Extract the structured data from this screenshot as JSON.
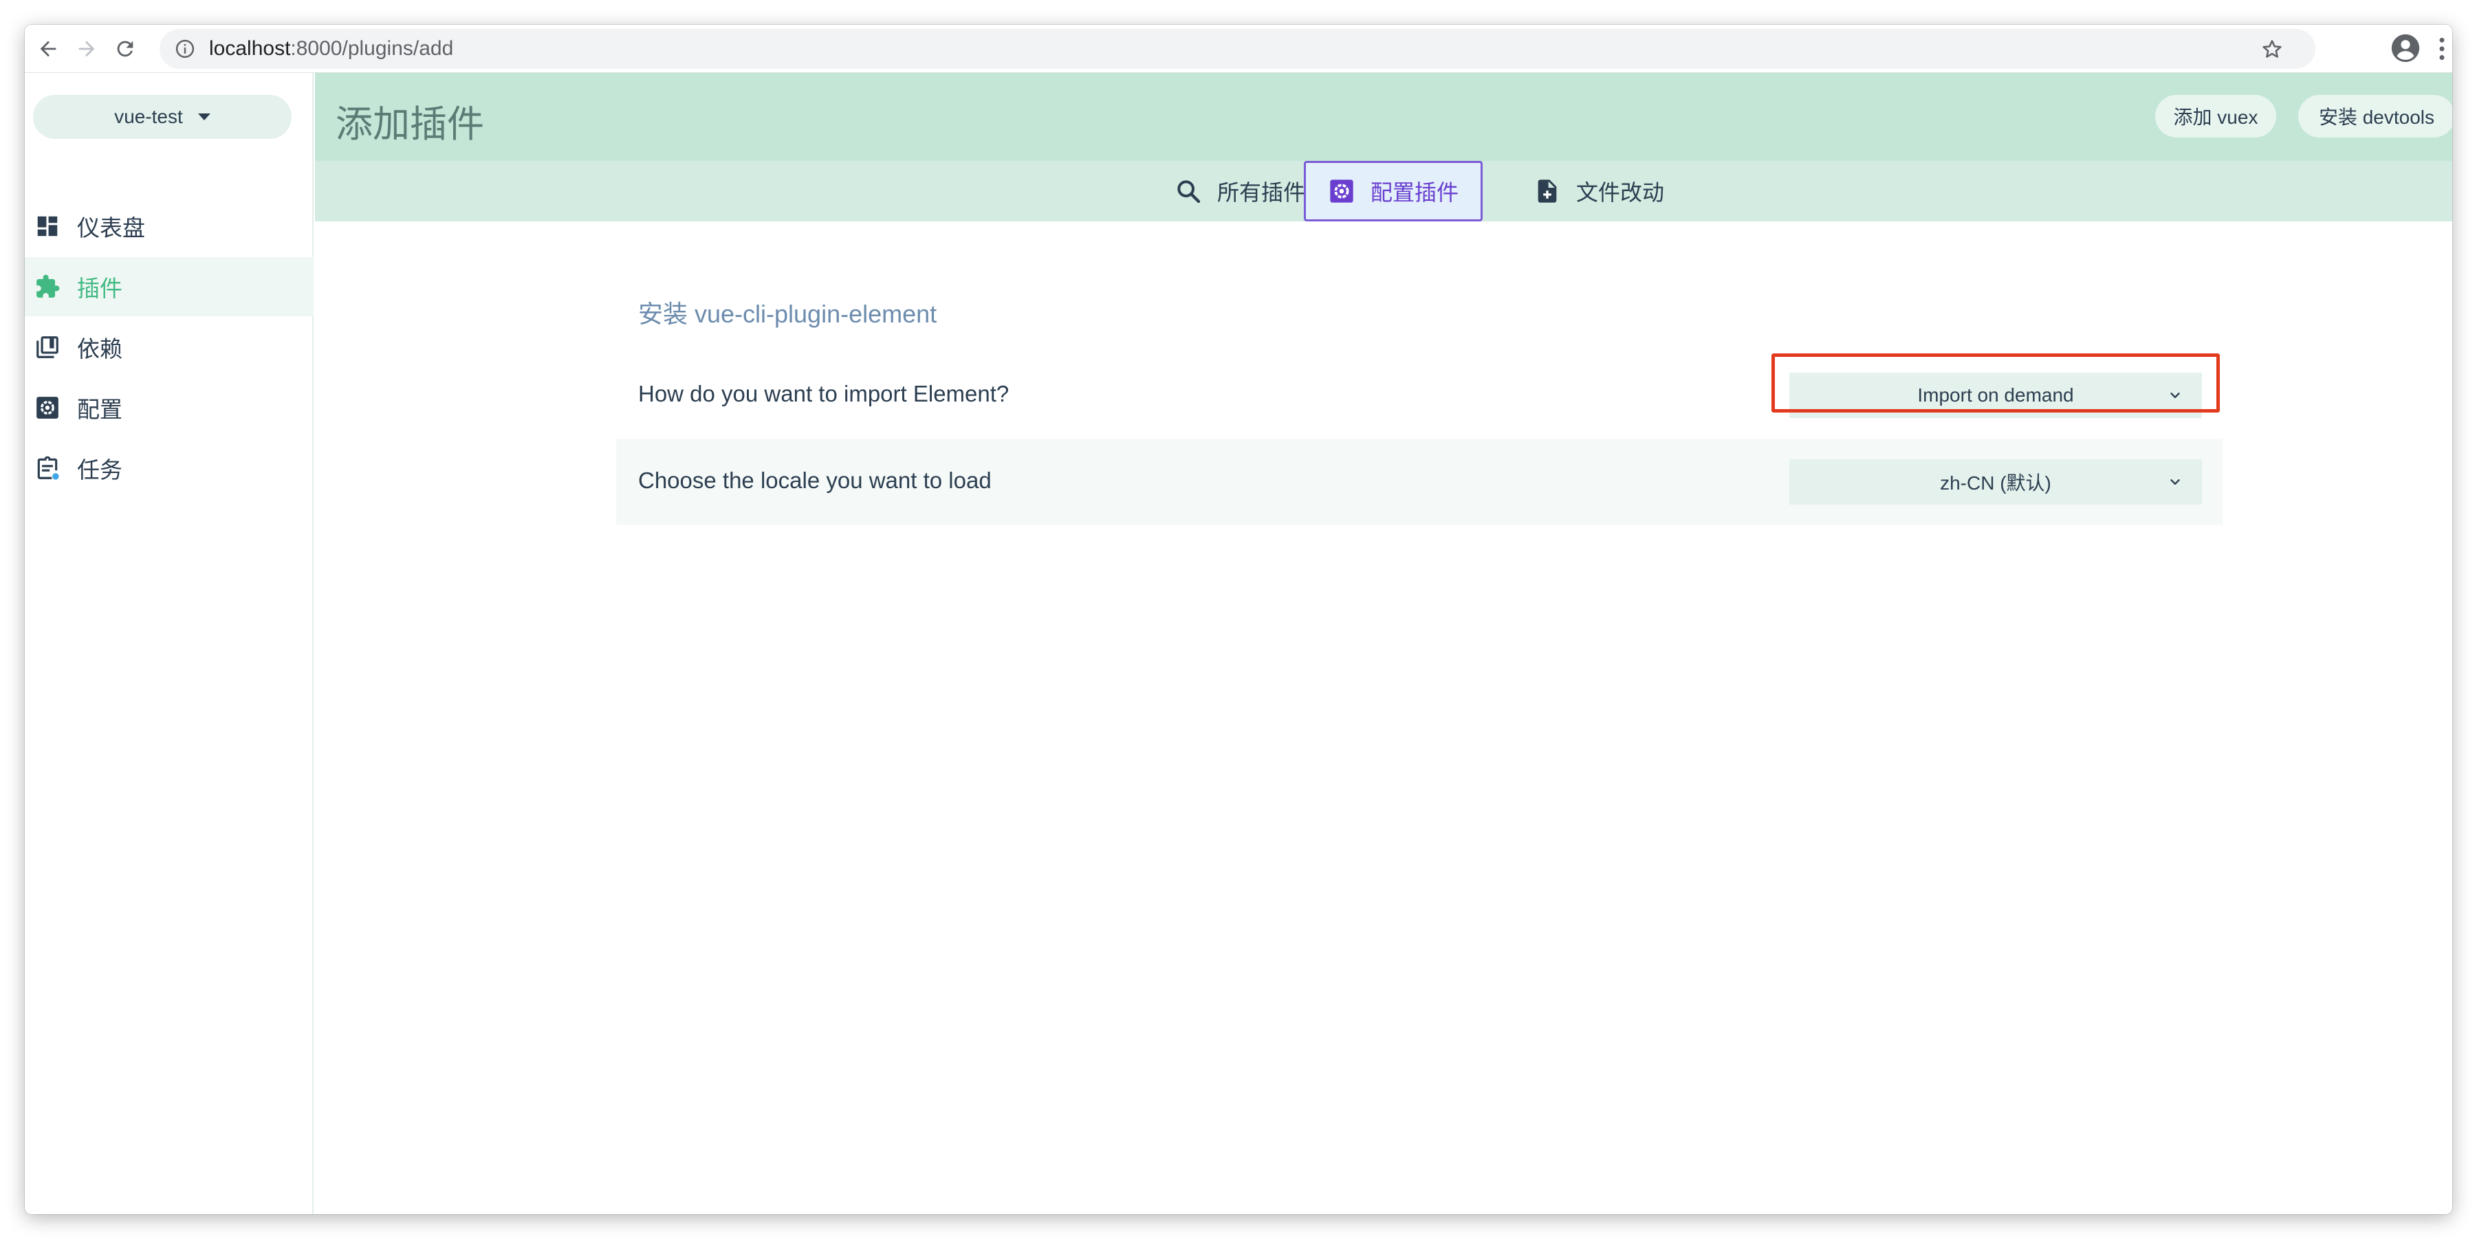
{
  "browser": {
    "url_host": "localhost",
    "url_path": ":8000/plugins/add"
  },
  "sidebar": {
    "project": "vue-test",
    "items": [
      {
        "label": "仪表盘",
        "icon": "dashboard-icon",
        "active": false
      },
      {
        "label": "插件",
        "icon": "puzzle-icon",
        "active": true
      },
      {
        "label": "依赖",
        "icon": "library-books-icon",
        "active": false
      },
      {
        "label": "配置",
        "icon": "settings-box-icon",
        "active": false
      },
      {
        "label": "任务",
        "icon": "clipboard-icon",
        "active": false
      }
    ]
  },
  "header": {
    "title": "添加插件",
    "buttons": [
      "添加 vuex",
      "安装 devtools"
    ]
  },
  "tabs": [
    {
      "label": "所有插件",
      "icon": "search-icon",
      "active": false
    },
    {
      "label": "配置插件",
      "icon": "settings-box-icon",
      "active": true
    },
    {
      "label": "文件改动",
      "icon": "file-plus-icon",
      "active": false
    }
  ],
  "form": {
    "section_title": "安装 vue-cli-plugin-element",
    "fields": [
      {
        "label": "How do you want to import Element?",
        "value": "Import on demand",
        "highlighted": true
      },
      {
        "label": "Choose the locale you want to load",
        "value": "zh-CN (默认)",
        "highlighted": false
      }
    ]
  },
  "colors": {
    "accent_green": "#42b983",
    "header_bg": "#c3e6d7",
    "tab_bar_bg": "#d3ebe1",
    "active_tab_border": "#7b5cd6",
    "highlight_red": "#e23a1c"
  }
}
